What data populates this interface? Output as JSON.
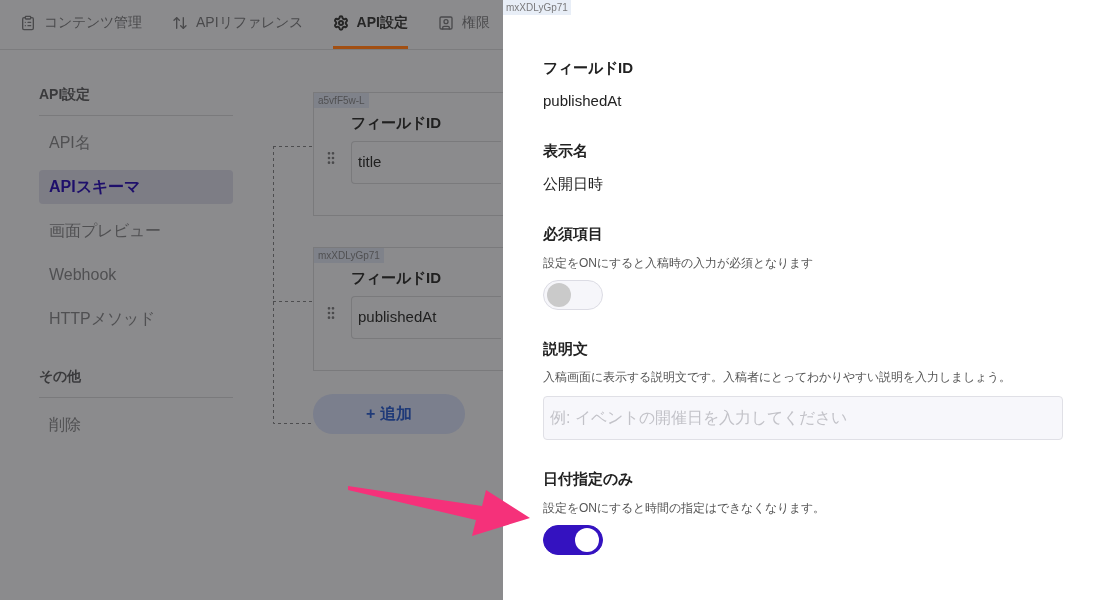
{
  "tabs": [
    {
      "label": "コンテンツ管理",
      "selected": false
    },
    {
      "label": "APIリファレンス",
      "selected": false
    },
    {
      "label": "API設定",
      "selected": true
    },
    {
      "label": "権限",
      "selected": false
    }
  ],
  "sidebar": {
    "groups": [
      {
        "title": "API設定",
        "items": [
          {
            "label": "API名",
            "selected": false
          },
          {
            "label": "APIスキーマ",
            "selected": true
          },
          {
            "label": "画面プレビュー",
            "selected": false
          },
          {
            "label": "Webhook",
            "selected": false
          },
          {
            "label": "HTTPメソッド",
            "selected": false
          }
        ]
      },
      {
        "title": "その他",
        "items": [
          {
            "label": "削除",
            "selected": false
          }
        ]
      }
    ]
  },
  "fields": [
    {
      "tag": "a5vfF5w-L",
      "label": "フィールドID",
      "value": "title"
    },
    {
      "tag": "mxXDLyGp71",
      "label": "フィールドID",
      "value": "publishedAt"
    }
  ],
  "add_button": "+ 追加",
  "panel": {
    "tag": "mxXDLyGp71",
    "sections": [
      {
        "kind": "text",
        "title": "フィールドID",
        "value": "publishedAt"
      },
      {
        "kind": "text",
        "title": "表示名",
        "value": "公開日時"
      },
      {
        "kind": "toggle",
        "title": "必須項目",
        "hint": "設定をONにすると入稿時の入力が必須となります",
        "on": false
      },
      {
        "kind": "textarea",
        "title": "説明文",
        "hint": "入稿画面に表示する説明文です。入稿者にとってわかりやすい説明を入力しましょう。",
        "placeholder": "例: イベントの開催日を入力してください"
      },
      {
        "kind": "toggle",
        "title": "日付指定のみ",
        "hint": "設定をONにすると時間の指定はできなくなります。",
        "on": true
      }
    ]
  }
}
